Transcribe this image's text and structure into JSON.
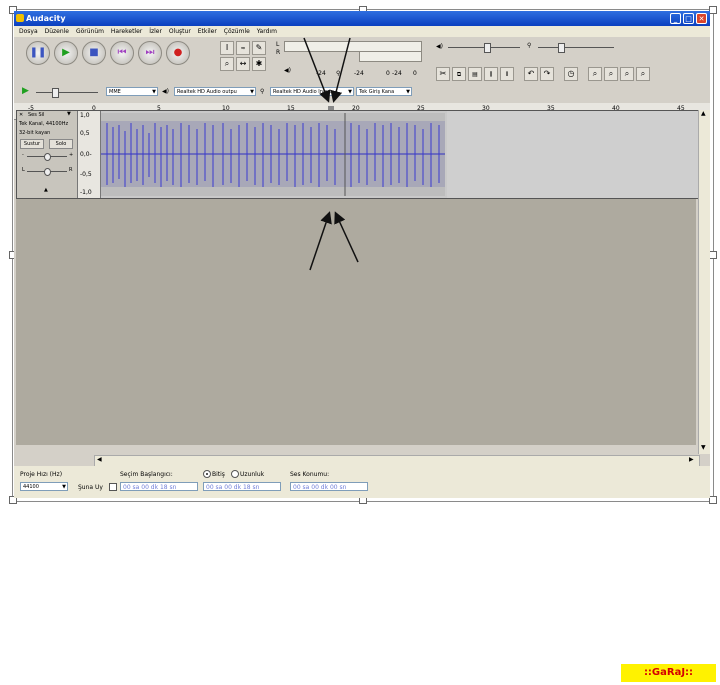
{
  "window": {
    "title": "Audacity"
  },
  "menu": [
    "Dosya",
    "Düzenle",
    "Görünüm",
    "Hareketler",
    "İzler",
    "Oluştur",
    "Etkiler",
    "Çözümle",
    "Yardım"
  ],
  "meters": {
    "left": "L",
    "right": "R",
    "db_values": [
      "-24",
      "-24",
      "0",
      "-24",
      "0"
    ]
  },
  "device": {
    "host": "MME",
    "output": "Realtek HD Audio outpu",
    "input": "Realtek HD Audio Input",
    "channels": "Tek Giriş Kana"
  },
  "ruler": {
    "ticks": [
      "-5",
      "0",
      "5",
      "10",
      "15",
      "20",
      "25",
      "30",
      "35",
      "40",
      "45"
    ]
  },
  "track": {
    "name": "Ses Sil",
    "info1": "Tek Kanal, 44100Hz",
    "info2": "32-bit kayan",
    "mute": "Sustur",
    "solo": "Solo",
    "gain_minus": "-",
    "gain_plus": "+",
    "pan_left": "L",
    "pan_right": "R",
    "scale": [
      "1,0",
      "0,5",
      "0,0-",
      "-0,5",
      "-1,0"
    ]
  },
  "status": {
    "rate_label": "Proje Hızı (Hz)",
    "rate_value": "44100",
    "snap_label": "Şuna Uy",
    "sel_start_label": "Seçim Başlangıcı:",
    "end_label": "Bitiş",
    "length_label": "Uzunluk",
    "pos_label": "Ses Konumu:",
    "time1": "00 sa 00 dk 18 sn",
    "time2": "00 sa 00 dk 18 sn",
    "time3": "00 sa 00 dk 00 sn"
  },
  "watermark": "::GaRaJ::"
}
